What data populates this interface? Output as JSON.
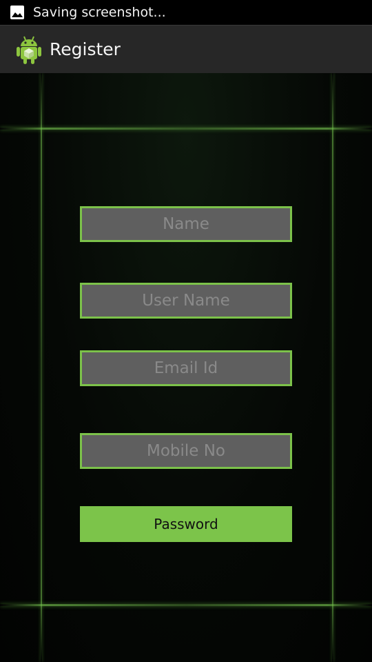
{
  "status_bar": {
    "notification_text": "Saving screenshot...",
    "icon": "image-icon"
  },
  "action_bar": {
    "title": "Register",
    "icon": "android-icon"
  },
  "form": {
    "name": {
      "placeholder": "Name",
      "value": ""
    },
    "username": {
      "placeholder": "User Name",
      "value": ""
    },
    "email": {
      "placeholder": "Email Id",
      "value": ""
    },
    "mobile": {
      "placeholder": "Mobile No",
      "value": ""
    },
    "submit_label": "Password"
  },
  "colors": {
    "accent_green": "#7cc24a",
    "field_bg": "#5f5f5f",
    "action_bar_bg": "#272727"
  }
}
